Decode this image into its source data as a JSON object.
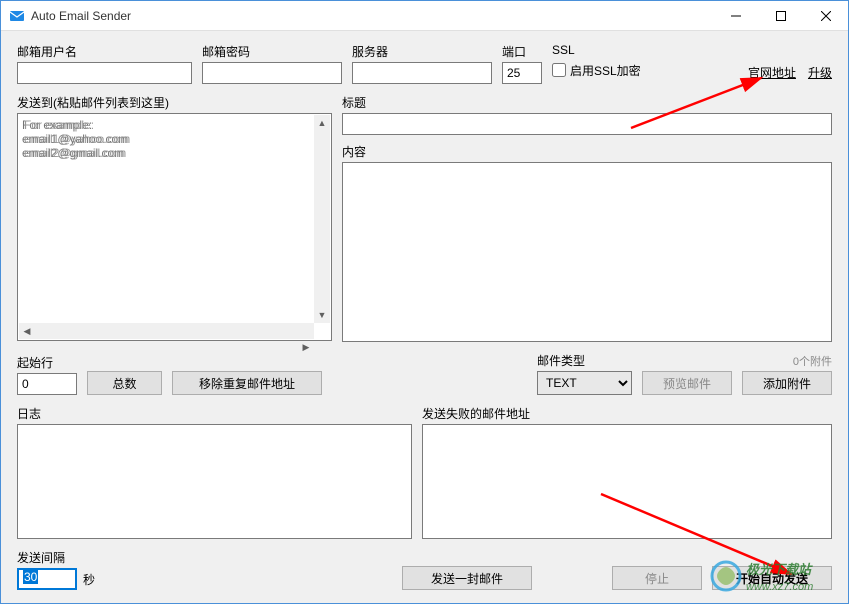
{
  "titlebar": {
    "title": "Auto Email Sender"
  },
  "top": {
    "username_label": "邮箱用户名",
    "password_label": "邮箱密码",
    "server_label": "服务器",
    "port_label": "端口",
    "port_value": "25",
    "ssl_label": "SSL",
    "ssl_checkbox": "启用SSL加密",
    "official_link": "官网地址",
    "upgrade_link": "升级"
  },
  "sendto": {
    "label": "发送到(粘贴邮件列表到这里)",
    "placeholder": "For example:\nemail1@yahoo.com\nemail2@gmail.com"
  },
  "subject": {
    "label": "标题"
  },
  "contentbox": {
    "label": "内容"
  },
  "startrow": {
    "label": "起始行",
    "value": "0",
    "total_btn": "总数",
    "dedup_btn": "移除重复邮件地址"
  },
  "mailtype": {
    "label": "邮件类型",
    "value": "TEXT",
    "preview_btn": "预览邮件",
    "attach_count": "0个附件",
    "add_attach_btn": "添加附件"
  },
  "log": {
    "label": "日志"
  },
  "failed": {
    "label": "发送失败的邮件地址"
  },
  "interval": {
    "label": "发送间隔",
    "value": "30",
    "unit": "秒"
  },
  "actions": {
    "send_one": "发送一封邮件",
    "stop": "停止",
    "start_auto": "开始自动发送"
  },
  "watermark": {
    "text1": "极光下载站",
    "text2": "www.xz7.com"
  }
}
